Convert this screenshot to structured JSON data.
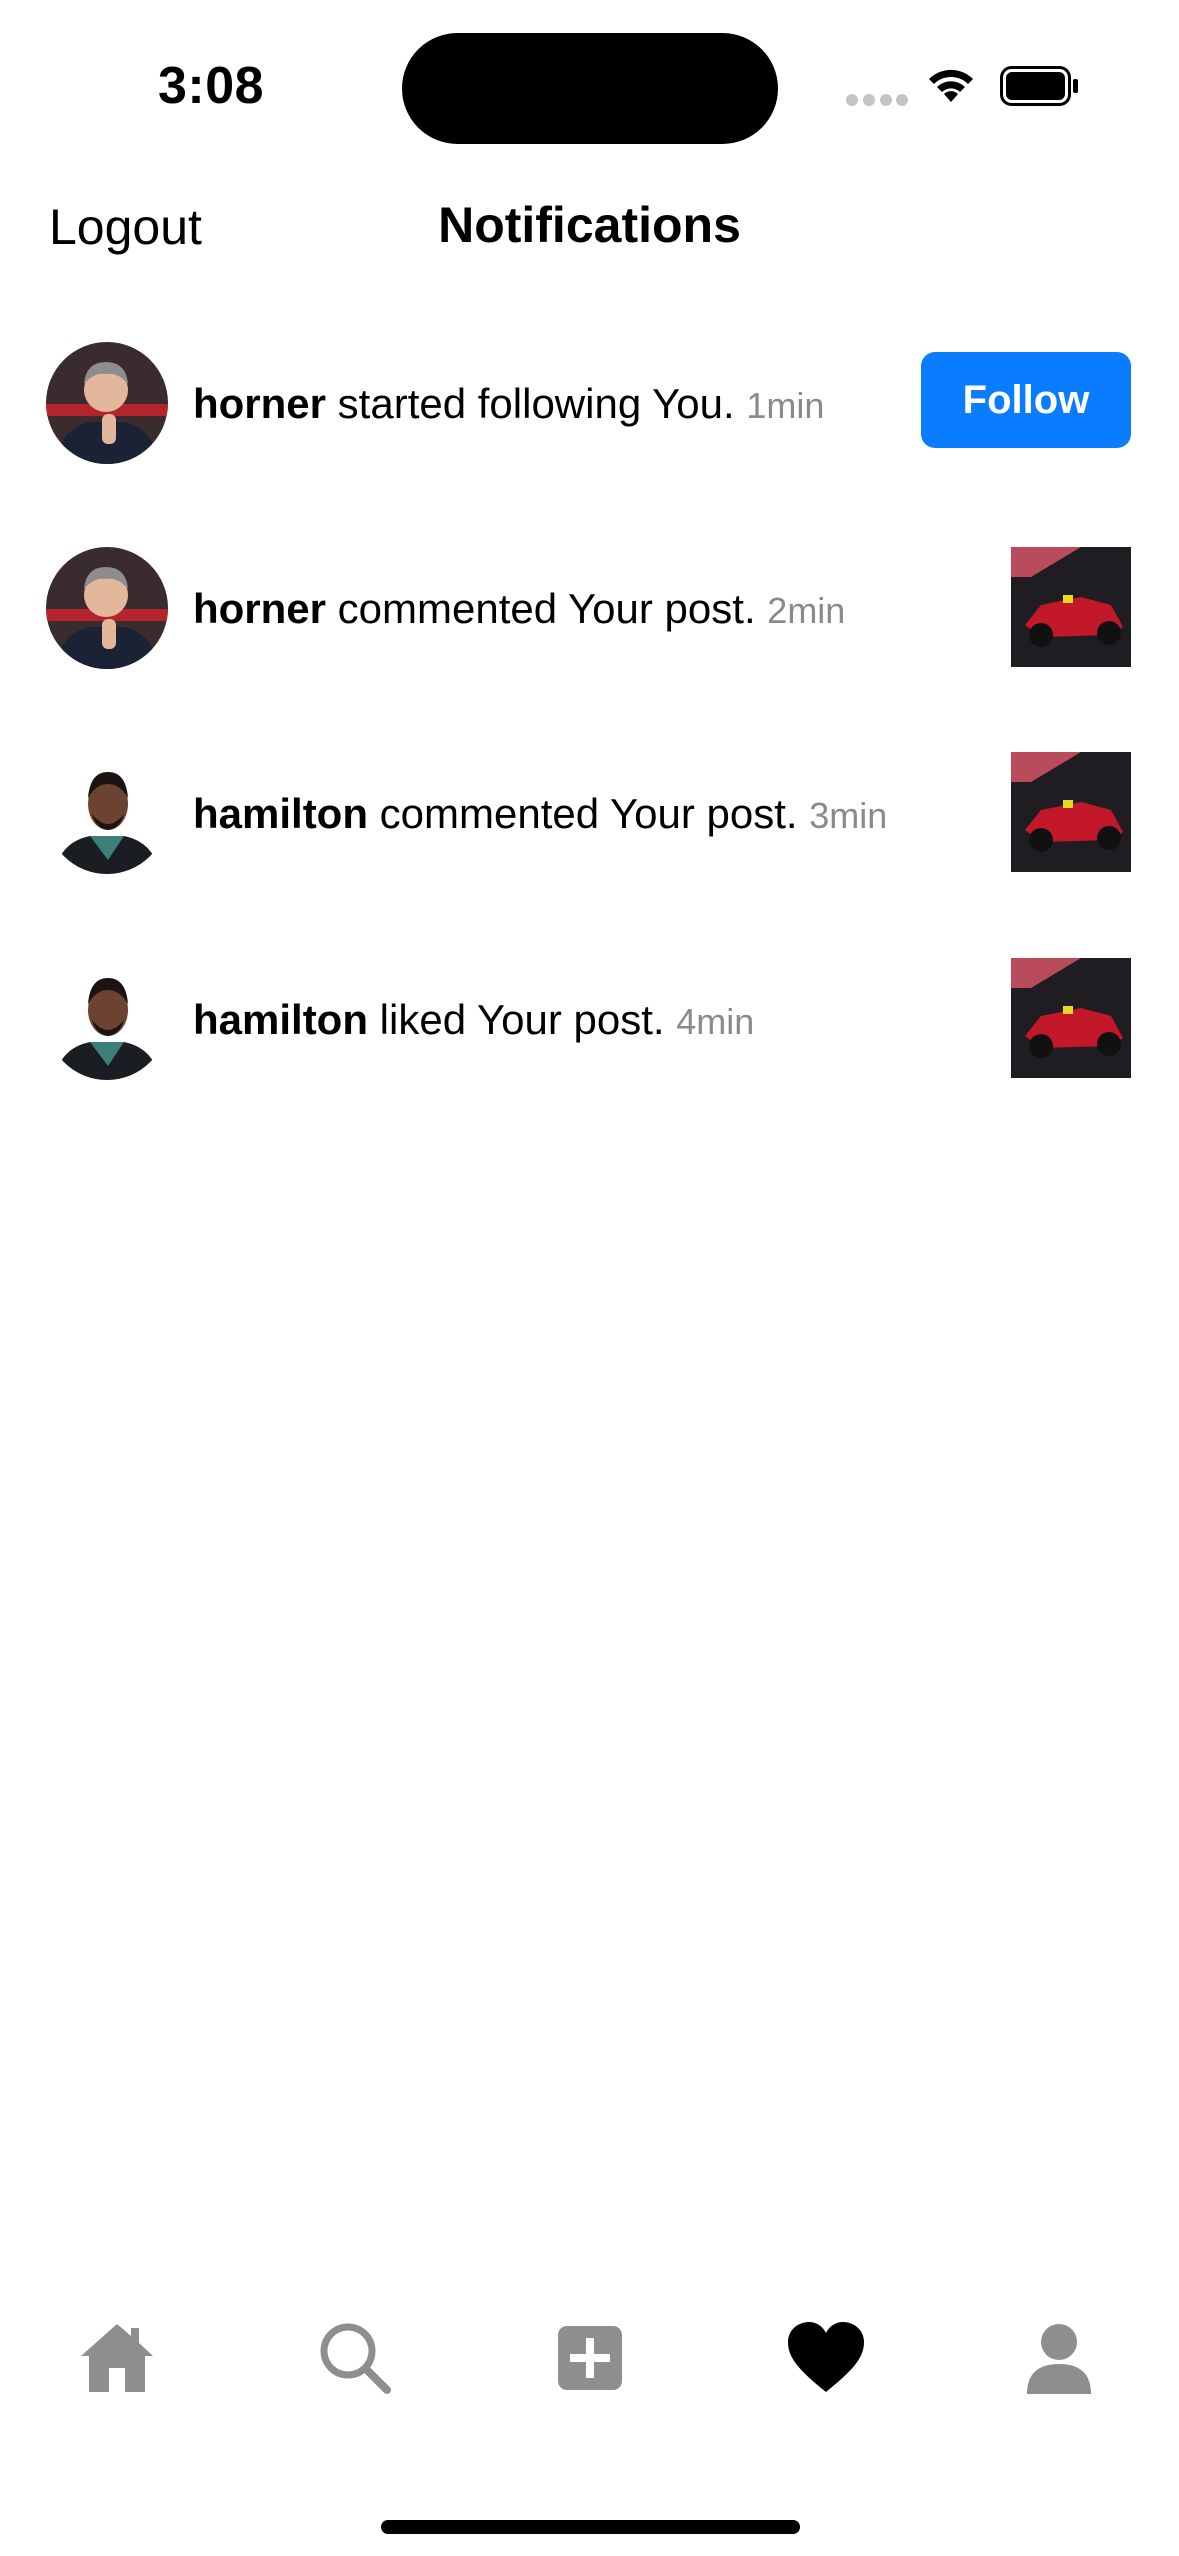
{
  "status_bar": {
    "time": "3:08"
  },
  "nav": {
    "logout": "Logout",
    "title": "Notifications"
  },
  "notifications": [
    {
      "user": "horner",
      "text": " started following You. ",
      "time": "1min",
      "action": "Follow"
    },
    {
      "user": "horner",
      "text": " commented Your post. ",
      "time": "2min"
    },
    {
      "user": "hamilton",
      "text": " commented Your post. ",
      "time": "3min"
    },
    {
      "user": "hamilton",
      "text": " liked Your post. ",
      "time": "4min"
    }
  ],
  "tab_bar": {
    "items": [
      {
        "icon": "home-icon"
      },
      {
        "icon": "search-icon"
      },
      {
        "icon": "add-post-icon"
      },
      {
        "icon": "heart-icon",
        "active": true
      },
      {
        "icon": "profile-icon"
      }
    ]
  },
  "colors": {
    "accent": "#0a7cff",
    "muted": "#8a8a8e",
    "tab_inactive": "#8e8e8e"
  }
}
